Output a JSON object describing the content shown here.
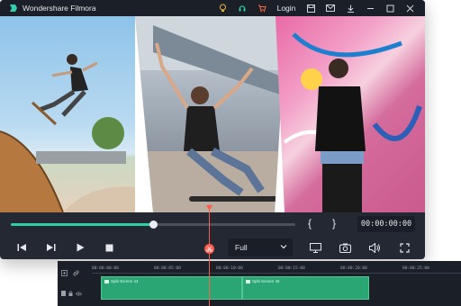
{
  "app": {
    "title": "Wondershare Filmora"
  },
  "titlebar": {
    "login_label": "Login",
    "icons": [
      "bulb-icon",
      "headset-icon",
      "cart-icon",
      "save-icon",
      "mail-icon",
      "download-icon",
      "minimize-icon",
      "maximize-icon",
      "close-icon"
    ]
  },
  "player": {
    "progress": 0.5,
    "mark_in": "{",
    "mark_out": "}",
    "timecode": "00:00:00:00",
    "quality_select": {
      "value": "Full"
    },
    "controls": [
      "step-back-icon",
      "step-forward-icon",
      "play-icon",
      "stop-icon",
      "display-icon",
      "snapshot-icon",
      "volume-icon",
      "fullscreen-icon"
    ]
  },
  "timeline": {
    "ruler": [
      "00:00:00:00",
      "00:00:05:00",
      "00:00:10:00",
      "00:00:15:00",
      "00:00:20:00",
      "00:00:25:00"
    ],
    "clips": [
      {
        "label": "Split Screen 44"
      },
      {
        "label": "Split Screen 45"
      }
    ]
  },
  "colors": {
    "accent": "#2ecfa4",
    "playhead": "#ff5a4a",
    "clip": "#2aa675",
    "window_bg": "#232833"
  }
}
